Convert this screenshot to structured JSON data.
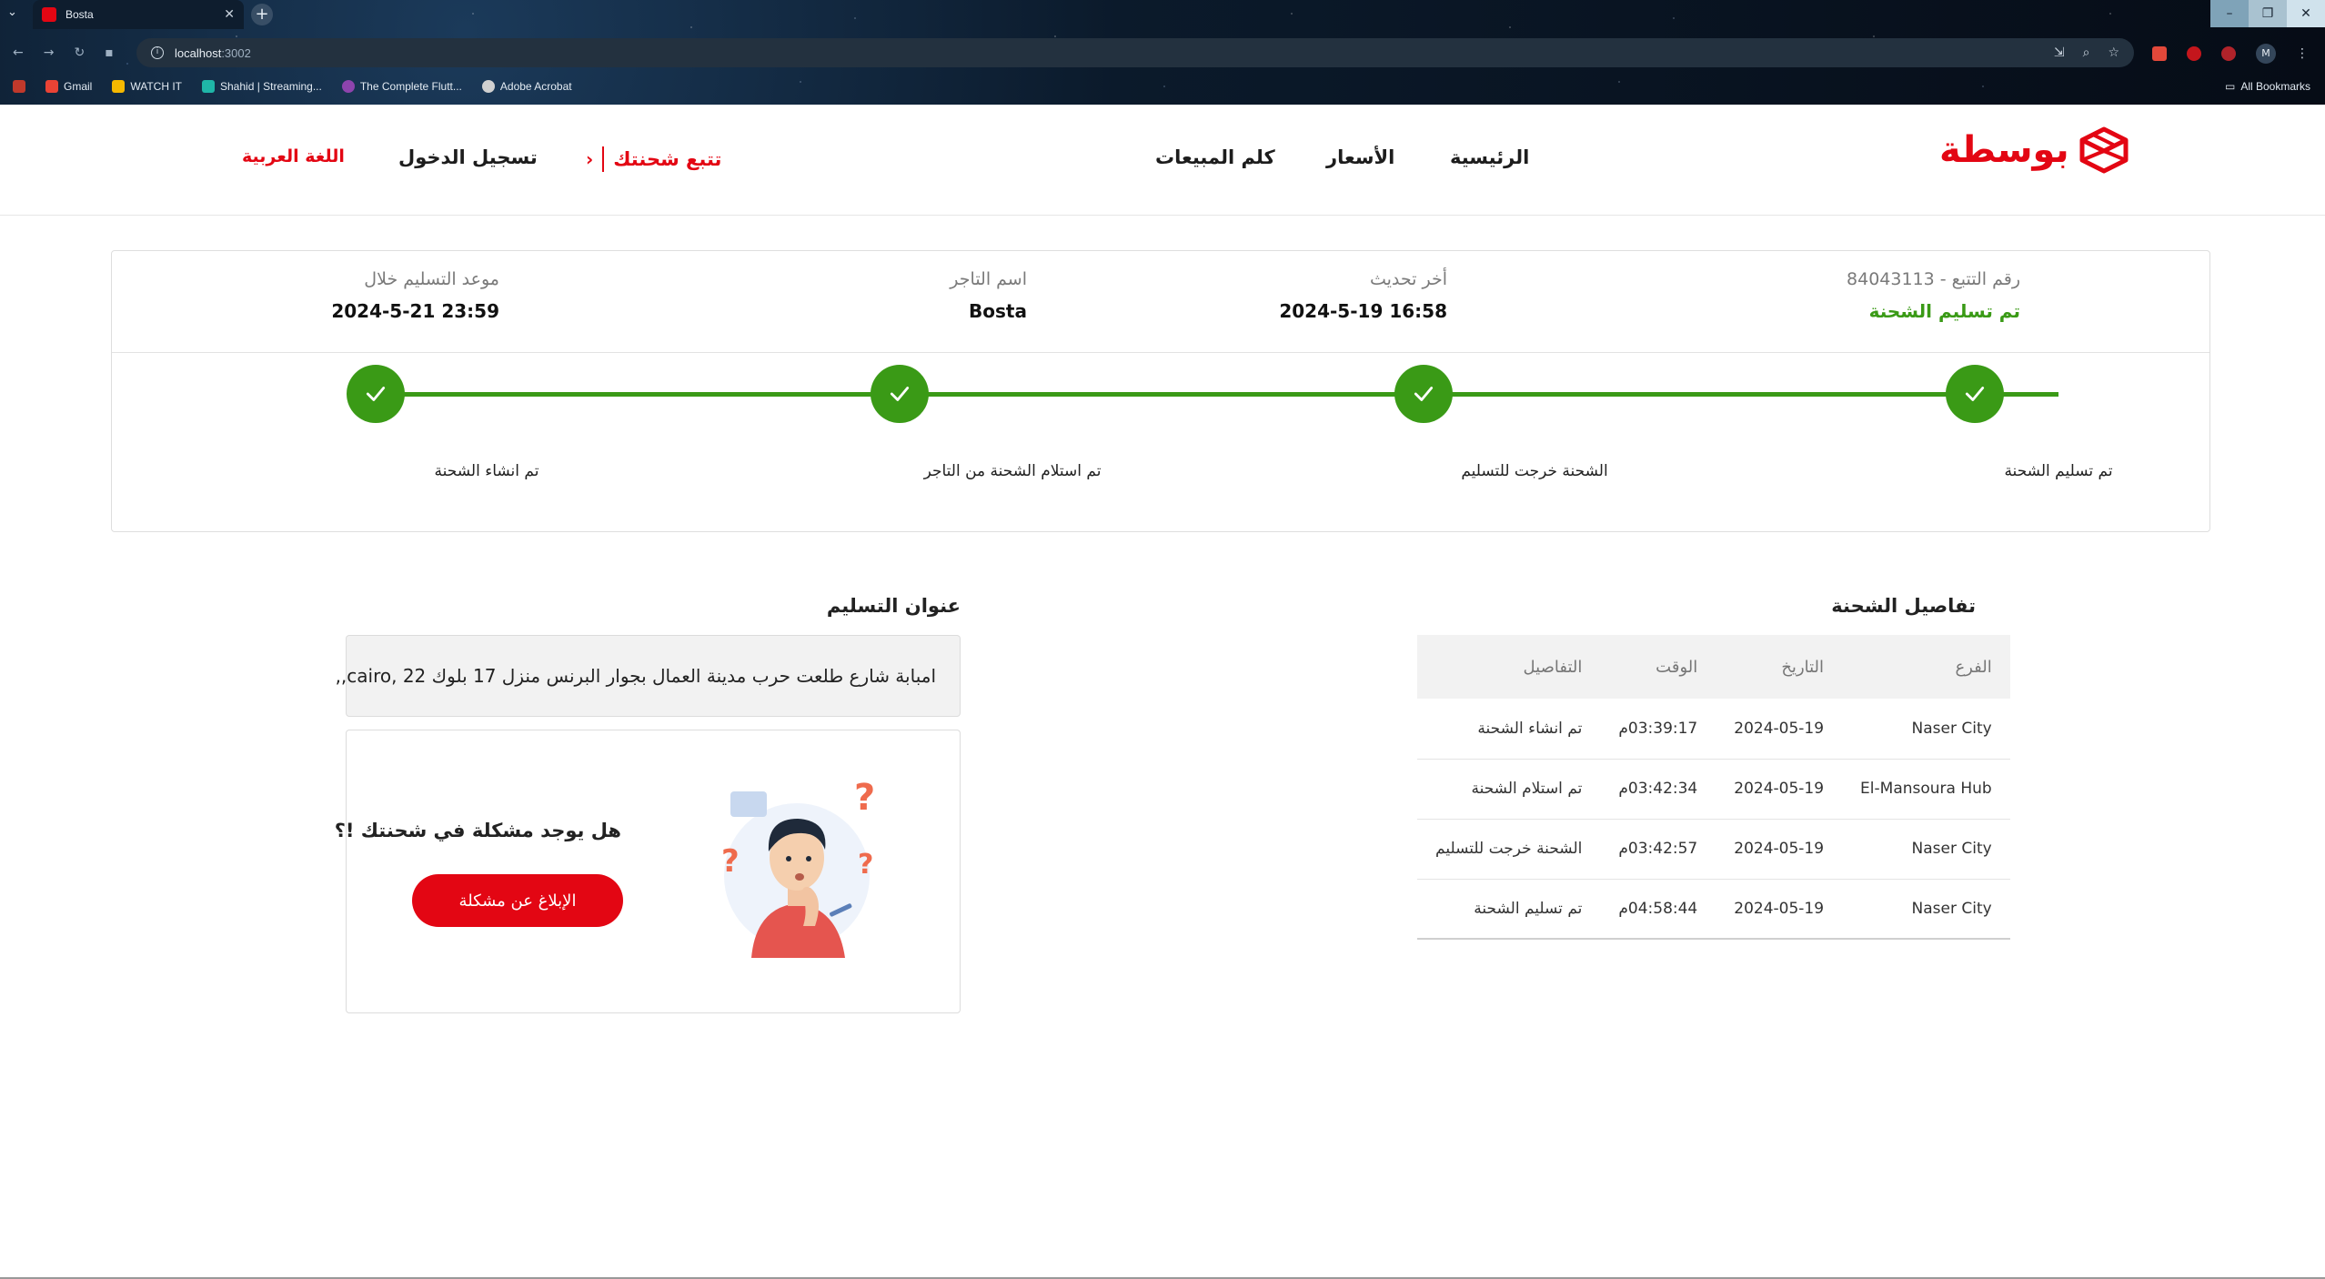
{
  "browser": {
    "tab_title": "Bosta",
    "url_host": "localhost",
    "url_port": ":3002",
    "bookmarks": [
      {
        "label": "Gmail",
        "color": "#ea4335"
      },
      {
        "label": "WATCH IT",
        "color": "#f5b800"
      },
      {
        "label": "Shahid | Streaming...",
        "color": "#1fb6a8"
      },
      {
        "label": "The Complete Flutt...",
        "color": "#8e44ad"
      },
      {
        "label": "Adobe Acrobat",
        "color": "#d0d0d0"
      }
    ],
    "all_bookmarks": "All Bookmarks",
    "profile_initial": "M"
  },
  "header": {
    "logo": "بوسطة",
    "nav": {
      "home": "الرئيسية",
      "prices": "الأسعار",
      "sales": "كلم المبيعات",
      "track": "تتبع شحنتك",
      "login": "تسجيل الدخول",
      "language": "اللغة العربية"
    }
  },
  "summary": {
    "tracking_label": "رقم التتبع - 84043113",
    "tracking_status": "تم تسليم الشحنة",
    "last_update_label": "أخر تحديث",
    "last_update_value": "16:58 2024-5-19",
    "merchant_label": "اسم التاجر",
    "merchant_value": "Bosta",
    "delivery_label": "موعد التسليم خلال",
    "delivery_value": "23:59 2024-5-21"
  },
  "progress": {
    "steps": [
      "تم تسليم الشحنة",
      "الشحنة خرجت للتسليم",
      "تم استلام الشحنة من التاجر",
      "تم انشاء الشحنة"
    ],
    "accent": "#3a9a16"
  },
  "details": {
    "title": "تفاصيل الشحنة",
    "columns": [
      "الفرع",
      "التاريخ",
      "الوقت",
      "التفاصيل"
    ],
    "rows": [
      {
        "branch": "Naser City",
        "date": "2024-05-19",
        "time": "03:39:17م",
        "details": "تم انشاء الشحنة"
      },
      {
        "branch": "El-Mansoura Hub",
        "date": "2024-05-19",
        "time": "03:42:34م",
        "details": "تم استلام الشحنة"
      },
      {
        "branch": "Naser City",
        "date": "2024-05-19",
        "time": "03:42:57م",
        "details": "الشحنة خرجت للتسليم"
      },
      {
        "branch": "Naser City",
        "date": "2024-05-19",
        "time": "04:58:44م",
        "details": "تم تسليم الشحنة"
      }
    ]
  },
  "address": {
    "title": "عنوان التسليم",
    "text": "امبابة شارع طلعت حرب مدينة العمال بجوار البرنس منزل 17 بلوك 22 ,cairo,,"
  },
  "problem": {
    "question": "هل يوجد مشكلة في شحنتك !؟",
    "button": "الإبلاغ عن مشكلة"
  },
  "colors": {
    "brand": "#e30613",
    "success": "#3a9a16"
  }
}
